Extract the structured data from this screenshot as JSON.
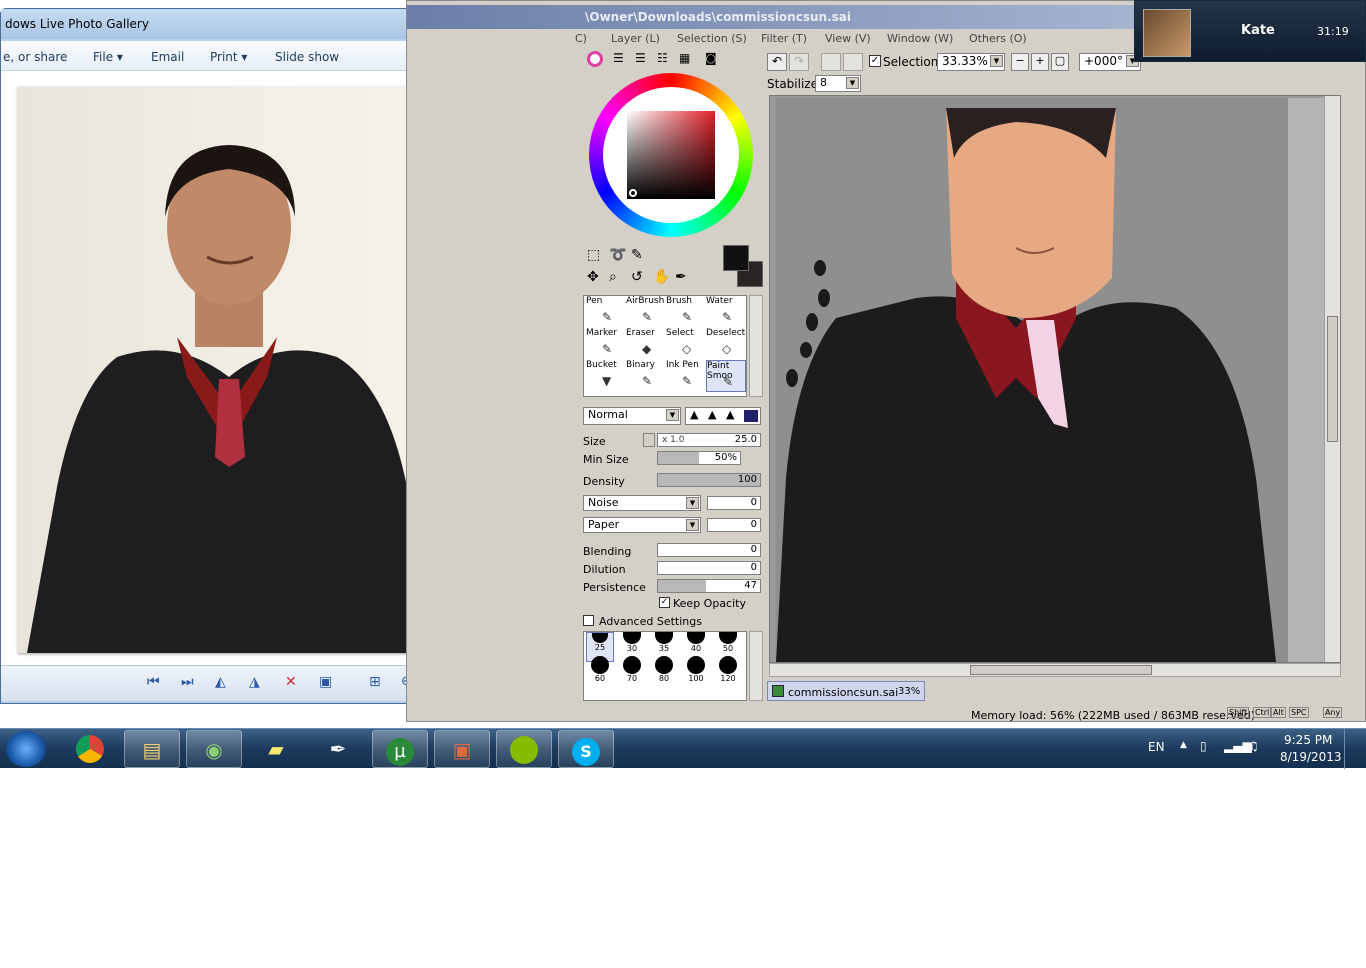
{
  "gallery": {
    "title": "dows Live Photo Gallery",
    "menu": [
      {
        "label": "e, or share"
      },
      {
        "label": "File ▾"
      },
      {
        "label": "Email"
      },
      {
        "label": "Print ▾"
      },
      {
        "label": "Slide show"
      }
    ],
    "help": "?",
    "photo_desc": "Graduation portrait photo"
  },
  "sai": {
    "title": "\\Owner\\Downloads\\commissioncsun.sai",
    "menu": [
      {
        "label": "C)"
      },
      {
        "label": "Layer (L)"
      },
      {
        "label": "Selection (S)"
      },
      {
        "label": "Filter (T)"
      },
      {
        "label": "View (V)"
      },
      {
        "label": "Window (W)"
      },
      {
        "label": "Others (O)"
      }
    ],
    "selection_label": "Selection",
    "zoom": "33.33%",
    "rotation": "+000°",
    "stabilizer_label": "Stabilizer",
    "stabilizer_value": "8",
    "tools": [
      {
        "label": "Pen"
      },
      {
        "label": "AirBrush"
      },
      {
        "label": "Brush"
      },
      {
        "label": "Water"
      },
      {
        "label": "Marker"
      },
      {
        "label": "Eraser"
      },
      {
        "label": "Select"
      },
      {
        "label": "Deselect"
      },
      {
        "label": "Bucket"
      },
      {
        "label": "Binary"
      },
      {
        "label": "Ink Pen"
      },
      {
        "label": "Paint Smoo"
      }
    ],
    "blend_mode": "Normal",
    "size_label": "Size",
    "size_mult": "x 1.0",
    "size_value": "25.0",
    "minsize_label": "Min Size",
    "minsize_value": "50%",
    "minsize_fill": 0.5,
    "density_label": "Density",
    "density_value": "100",
    "density_fill": 1.0,
    "noise_label": "Noise",
    "noise_value": "0",
    "paper_label": "Paper",
    "paper_value": "0",
    "blending_label": "Blending",
    "blending_value": "0",
    "dilution_label": "Dilution",
    "dilution_value": "0",
    "persistence_label": "Persistence",
    "persistence_value": "47",
    "persistence_fill": 0.47,
    "keep_opacity": "Keep Opacity",
    "advanced": "Advanced Settings",
    "brush_sizes": [
      "25",
      "30",
      "35",
      "40",
      "50",
      "60",
      "70",
      "80",
      "100",
      "120"
    ],
    "doc_tab": "commissioncsun.sai",
    "doc_zoom": "33%",
    "memory": "Memory load: 56% (222MB used / 863MB reserved)",
    "mods": [
      "Shift",
      "Ctrl",
      "Alt",
      "SPC",
      "Any"
    ]
  },
  "skype": {
    "name": "Kate",
    "time": "31:19"
  },
  "taskbar": {
    "lang": "EN",
    "time": "9:25 PM",
    "date": "8/19/2013"
  },
  "colors": {
    "primary": "#111111",
    "secondary": "#2a2424"
  }
}
